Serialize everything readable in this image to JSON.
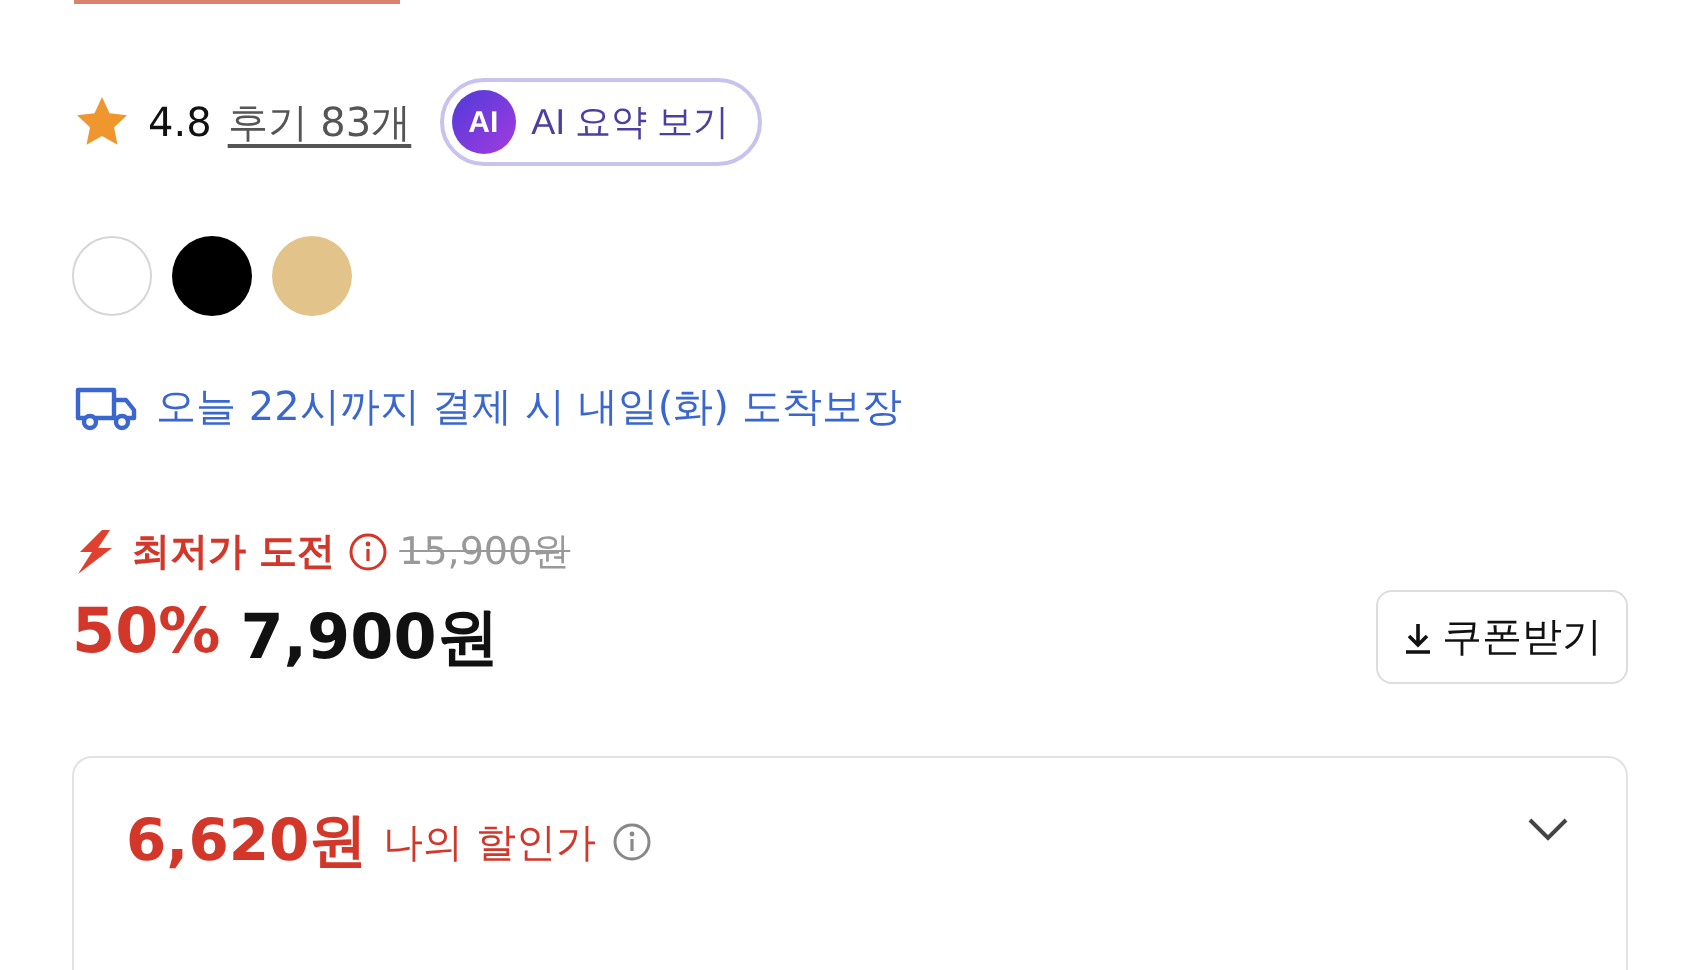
{
  "rating": {
    "score": "4.8",
    "reviews": "후기 83개"
  },
  "ai_summary": {
    "badge": "AI",
    "label": "AI 요약 보기"
  },
  "swatches": [
    {
      "color": "#ffffff"
    },
    {
      "color": "#000000"
    },
    {
      "color": "#e2c48a"
    }
  ],
  "delivery": {
    "text": "오늘 22시까지 결제 시 내일(화) 도착보장"
  },
  "price": {
    "promo": "최저가 도전",
    "original": "15,900원",
    "discount": "50%",
    "sale": "7,900원",
    "coupon_button": "쿠폰받기"
  },
  "my_price": {
    "amount": "6,620원",
    "label": "나의 할인가",
    "expanded": false
  }
}
